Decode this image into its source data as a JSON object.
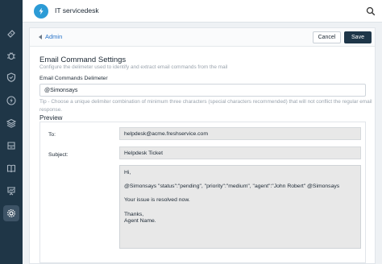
{
  "app": {
    "title": "IT servicedesk"
  },
  "sidebar": {
    "items": [
      {
        "icon": "ticket-icon"
      },
      {
        "icon": "bug-icon"
      },
      {
        "icon": "shield-icon"
      },
      {
        "icon": "lightning-icon"
      },
      {
        "icon": "layers-icon"
      },
      {
        "icon": "archive-icon"
      },
      {
        "icon": "book-icon"
      },
      {
        "icon": "presentation-icon"
      },
      {
        "icon": "gear-icon",
        "active": true
      }
    ]
  },
  "header": {
    "back_label": "Admin",
    "cancel_label": "Cancel",
    "save_label": "Save"
  },
  "settings": {
    "title": "Email Command Settings",
    "description": "Configure the delimeter used to identify and extract email commands from the mail",
    "delimiter_label": "Email Commands Delimeter",
    "delimiter_value": "@Simonsays",
    "tip": "Tip - Choose a unique delimiter combination of minimum three characters (special characters recommended) that will not conflict the regular email response."
  },
  "preview": {
    "title": "Preview",
    "to_label": "To:",
    "to_value": "helpdesk@acme.freshservice.com",
    "subject_label": "Subject:",
    "subject_value": "Helpdesk Ticket",
    "body": {
      "greeting": "Hi,",
      "command": "@Simonsays  \"status\":\"pending\", \"priority\":\"medium\", \"agent\":\"John Robert\" @Simonsays",
      "message": "Your issue is resolved now.",
      "signoff": "Thanks,",
      "signature": "Agent Name."
    }
  },
  "colors": {
    "sidebar_bg": "#1f3647",
    "logo_bg": "#2c9bd6",
    "save_bg": "#1e3649",
    "link": "#2773c9"
  }
}
